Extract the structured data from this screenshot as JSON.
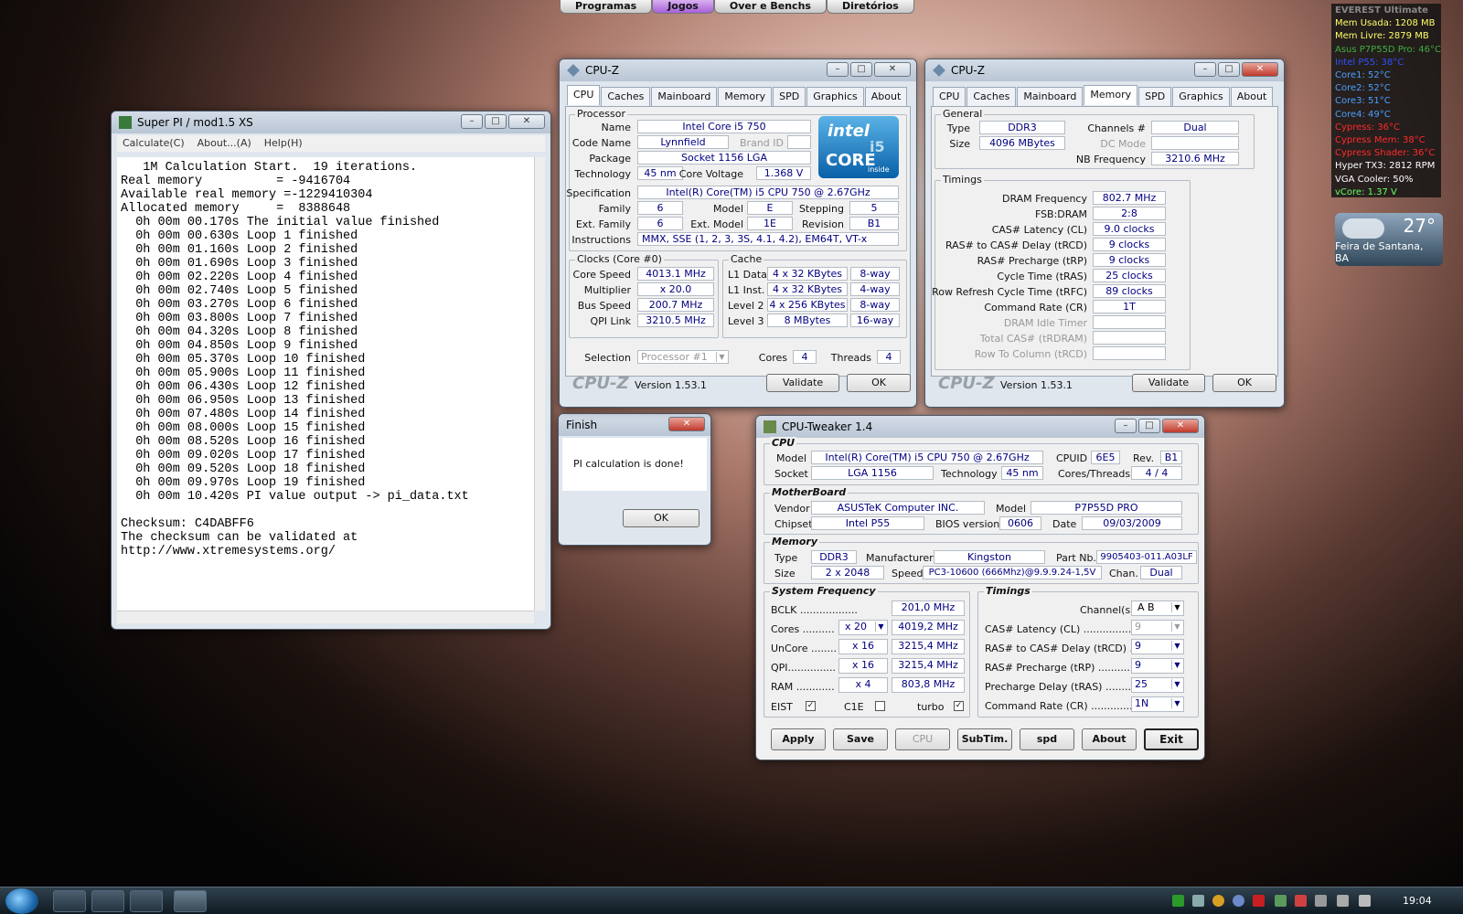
{
  "topbar": {
    "items": [
      "Programas",
      "Jogos",
      "Over e Benchs",
      "Diretórios"
    ]
  },
  "everest": {
    "title": "EVEREST Ultimate",
    "lines": [
      {
        "t": "Mem Usada: 1208 MB",
        "c": "#ffff66"
      },
      {
        "t": "Mem Livre: 2879 MB",
        "c": "#ffff66"
      },
      {
        "t": "Asus P7P55D Pro: 46°C",
        "c": "#3fae3f"
      },
      {
        "t": "Intel P55: 38°C",
        "c": "#3050ff"
      },
      {
        "t": "Core1: 52°C",
        "c": "#4aa0ff"
      },
      {
        "t": "Core2: 52°C",
        "c": "#4aa0ff"
      },
      {
        "t": "Core3: 51°C",
        "c": "#4aa0ff"
      },
      {
        "t": "Core4: 49°C",
        "c": "#4aa0ff"
      },
      {
        "t": "Cypress: 36°C",
        "c": "#ff2a2a"
      },
      {
        "t": "Cypress Mem: 38°C",
        "c": "#ff2a2a"
      },
      {
        "t": "Cypress Shader: 36°C",
        "c": "#ff2a2a"
      },
      {
        "t": "Hyper TX3: 2812 RPM",
        "c": "#ffffff"
      },
      {
        "t": "VGA Cooler: 50%",
        "c": "#ffffff"
      },
      {
        "t": "vCore: 1.37 V",
        "c": "#66ff66"
      }
    ]
  },
  "weather": {
    "temp": "27°",
    "city": "Feira de Santana, BA"
  },
  "superpi": {
    "title": "Super PI / mod1.5 XS",
    "menu": [
      "Calculate(C)",
      "About...(A)",
      "Help(H)"
    ],
    "lines": [
      "   1M Calculation Start.  19 iterations.",
      "Real memory          = -9416704",
      "Available real memory =-1229410304",
      "Allocated memory     =  8388648",
      "  0h 00m 00.170s The initial value finished",
      "  0h 00m 00.630s Loop 1 finished",
      "  0h 00m 01.160s Loop 2 finished",
      "  0h 00m 01.690s Loop 3 finished",
      "  0h 00m 02.220s Loop 4 finished",
      "  0h 00m 02.740s Loop 5 finished",
      "  0h 00m 03.270s Loop 6 finished",
      "  0h 00m 03.800s Loop 7 finished",
      "  0h 00m 04.320s Loop 8 finished",
      "  0h 00m 04.850s Loop 9 finished",
      "  0h 00m 05.370s Loop 10 finished",
      "  0h 00m 05.900s Loop 11 finished",
      "  0h 00m 06.430s Loop 12 finished",
      "  0h 00m 06.950s Loop 13 finished",
      "  0h 00m 07.480s Loop 14 finished",
      "  0h 00m 08.000s Loop 15 finished",
      "  0h 00m 08.520s Loop 16 finished",
      "  0h 00m 09.020s Loop 17 finished",
      "  0h 00m 09.520s Loop 18 finished",
      "  0h 00m 09.970s Loop 19 finished",
      "  0h 00m 10.420s PI value output -> pi_data.txt",
      "",
      "Checksum: C4DABFF6",
      "The checksum can be validated at",
      "http://www.xtremesystems.org/"
    ]
  },
  "finish": {
    "title": "Finish",
    "message": "PI calculation is done!",
    "ok": "OK"
  },
  "cpuz_common": {
    "title": "CPU-Z",
    "tabs": [
      "CPU",
      "Caches",
      "Mainboard",
      "Memory",
      "SPD",
      "Graphics",
      "About"
    ],
    "logo": "CPU-Z",
    "version": "Version 1.53.1",
    "validate": "Validate",
    "ok": "OK"
  },
  "cpuz1": {
    "grp_processor": "Processor",
    "name_l": "Name",
    "name": "Intel Core i5 750",
    "codename_l": "Code Name",
    "codename": "Lynnfield",
    "brandid_l": "Brand ID",
    "package_l": "Package",
    "package": "Socket 1156 LGA",
    "tech_l": "Technology",
    "tech": "45 nm",
    "cv_l": "Core Voltage",
    "cv": "1.368 V",
    "spec_l": "Specification",
    "spec": "Intel(R) Core(TM) i5 CPU       750  @ 2.67GHz",
    "family_l": "Family",
    "family": "6",
    "model_l": "Model",
    "model": "E",
    "stepping_l": "Stepping",
    "stepping": "5",
    "extfam_l": "Ext. Family",
    "extfam": "6",
    "extmodel_l": "Ext. Model",
    "extmodel": "1E",
    "rev_l": "Revision",
    "rev": "B1",
    "instr_l": "Instructions",
    "instr": "MMX, SSE (1, 2, 3, 3S, 4.1, 4.2), EM64T, VT-x",
    "grp_clocks": "Clocks (Core #0)",
    "cs_l": "Core Speed",
    "cs": "4013.1 MHz",
    "mult_l": "Multiplier",
    "mult": "x 20.0",
    "bus_l": "Bus Speed",
    "bus": "200.7 MHz",
    "qpi_l": "QPI Link",
    "qpi": "3210.5 MHz",
    "grp_cache": "Cache",
    "l1d_l": "L1 Data",
    "l1d": "4 x 32 KBytes",
    "l1d_w": "8-way",
    "l1i_l": "L1 Inst.",
    "l1i": "4 x 32 KBytes",
    "l1i_w": "4-way",
    "l2_l": "Level 2",
    "l2": "4 x 256 KBytes",
    "l2_w": "8-way",
    "l3_l": "Level 3",
    "l3": "8 MBytes",
    "l3_w": "16-way",
    "sel_l": "Selection",
    "sel": "Processor #1",
    "cores_l": "Cores",
    "cores": "4",
    "threads_l": "Threads",
    "threads": "4",
    "logo_intel": "intel",
    "logo_core": "CORE",
    "logo_i5": "i5",
    "logo_inside": "inside"
  },
  "cpuz2": {
    "grp_general": "General",
    "type_l": "Type",
    "type": "DDR3",
    "ch_l": "Channels #",
    "ch": "Dual",
    "size_l": "Size",
    "size": "4096 MBytes",
    "dc_l": "DC Mode",
    "nb_l": "NB Frequency",
    "nb": "3210.6 MHz",
    "grp_timings": "Timings",
    "rows": [
      {
        "l": "DRAM Frequency",
        "v": "802.7 MHz",
        "dim": false
      },
      {
        "l": "FSB:DRAM",
        "v": "2:8",
        "dim": false
      },
      {
        "l": "CAS# Latency (CL)",
        "v": "9.0 clocks",
        "dim": false
      },
      {
        "l": "RAS# to CAS# Delay (tRCD)",
        "v": "9 clocks",
        "dim": false
      },
      {
        "l": "RAS# Precharge (tRP)",
        "v": "9 clocks",
        "dim": false
      },
      {
        "l": "Cycle Time (tRAS)",
        "v": "25 clocks",
        "dim": false
      },
      {
        "l": "Row Refresh Cycle Time (tRFC)",
        "v": "89 clocks",
        "dim": false
      },
      {
        "l": "Command Rate (CR)",
        "v": "1T",
        "dim": false
      },
      {
        "l": "DRAM Idle Timer",
        "v": "",
        "dim": true
      },
      {
        "l": "Total CAS# (tRDRAM)",
        "v": "",
        "dim": true
      },
      {
        "l": "Row To Column (tRCD)",
        "v": "",
        "dim": true
      }
    ]
  },
  "tweaker": {
    "title": "CPU-Tweaker 1.4",
    "grp_cpu": "CPU",
    "model_l": "Model",
    "model": "Intel(R) Core(TM) i5 CPU       750  @ 2.67GHz",
    "cpuid_l": "CPUID",
    "cpuid": "6E5",
    "rev_l": "Rev.",
    "rev": "B1",
    "socket_l": "Socket",
    "socket": "LGA 1156",
    "tech_l": "Technology",
    "tech": "45 nm",
    "ct_l": "Cores/Threads",
    "ct": "4 / 4",
    "grp_mb": "MotherBoard",
    "vendor_l": "Vendor",
    "vendor": "ASUSTeK Computer INC.",
    "mbmodel_l": "Model",
    "mbmodel": "P7P55D PRO",
    "chipset_l": "Chipset",
    "chipset": "Intel P55",
    "bios_l": "BIOS version",
    "bios": "0606",
    "date_l": "Date",
    "date": "09/03/2009",
    "grp_mem": "Memory",
    "mtype_l": "Type",
    "mtype": "DDR3",
    "manu_l": "Manufacturer",
    "manu": "Kingston",
    "part_l": "Part Nb.",
    "part": "9905403-011.A03LF",
    "msize_l": "Size",
    "msize": "2 x 2048",
    "speed_l": "Speed",
    "speed": "PC3-10600 (666Mhz)@9.9.9.24-1,5V",
    "chan_l": "Chan.",
    "chan": "Dual",
    "grp_sf": "System Frequency",
    "bclk_l": "BCLK ..................",
    "bclk": "201,0 MHz",
    "cores_l": "Cores ..........",
    "cores_m": "x 20",
    "cores_v": "4019,2 MHz",
    "uncore_l": "UnCore ........",
    "uncore_m": "x 16",
    "uncore_v": "3215,4 MHz",
    "qpi_l": "QPI...............",
    "qpi_m": "x 16",
    "qpi_v": "3215,4 MHz",
    "ram_l": "RAM ............",
    "ram_m": "x 4",
    "ram_v": "803,8 MHz",
    "eist_l": "EIST",
    "c1e_l": "C1E",
    "turbo_l": "turbo",
    "eist": true,
    "c1e": false,
    "turbo": true,
    "grp_tim": "Timings",
    "chs_l": "Channel(s)",
    "chs": "A  B",
    "cl_l": "CAS# Latency (CL) ..................",
    "cl": "9",
    "rcd_l": "RAS# to CAS# Delay (tRCD) ........",
    "rcd": "9",
    "rp_l": "RAS# Precharge (tRP) ..............",
    "rp": "9",
    "ras_l": "Precharge Delay (tRAS) ..........",
    "ras": "25",
    "cr_l": "Command Rate (CR) ..................",
    "cr": "1N",
    "buttons": [
      "Apply",
      "Save",
      "CPU",
      "SubTim.",
      "spd",
      "About",
      "Exit"
    ]
  },
  "taskbar": {
    "clock": "19:04"
  }
}
